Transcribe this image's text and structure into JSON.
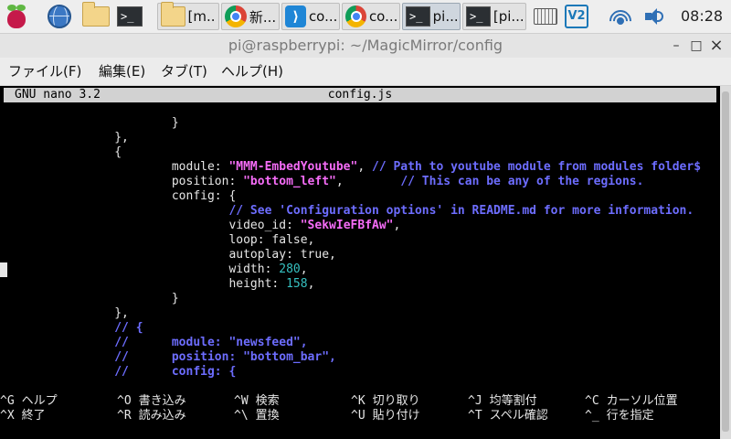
{
  "taskbar": {
    "items": [
      {
        "icon": "raspberry-pi-menu-icon"
      },
      {
        "icon": "web-browser-icon"
      },
      {
        "icon": "file-manager-icon"
      },
      {
        "icon": "terminal-icon",
        "label": ">_"
      },
      {
        "icon": "folder-icon",
        "label": "[m..."
      },
      {
        "icon": "chromium-icon",
        "label": "新..."
      },
      {
        "icon": "vscode-icon",
        "label": "co..."
      },
      {
        "icon": "chromium-icon",
        "label": "co..."
      },
      {
        "icon": "terminal-icon",
        "label": "pi..."
      },
      {
        "icon": "terminal-icon",
        "label": "[pi..."
      }
    ],
    "clock": "08:28"
  },
  "window": {
    "title": "pi@raspberrypi: ~/MagicMirror/config",
    "controls": {
      "minimize": "–",
      "maximize": "□",
      "close": "×"
    }
  },
  "menubar": [
    {
      "label": "ファイル(F)"
    },
    {
      "label": "編集(E)"
    },
    {
      "label": "タブ(T)"
    },
    {
      "label": "ヘルプ(H)"
    }
  ],
  "nano": {
    "version": "GNU nano 3.2",
    "filename": "config.js"
  },
  "code_lines": [
    [
      {
        "t": "                        }",
        "c": "kw"
      }
    ],
    [
      {
        "t": "                },",
        "c": "kw"
      }
    ],
    [
      {
        "t": "                {",
        "c": "kw"
      }
    ],
    [
      {
        "t": "                        module: ",
        "c": "kw"
      },
      {
        "t": "\"MMM-EmbedYoutube\"",
        "c": "str"
      },
      {
        "t": ", ",
        "c": "kw"
      },
      {
        "t": "// Path to youtube module from modules folder$",
        "c": "cm"
      }
    ],
    [
      {
        "t": "                        position: ",
        "c": "kw"
      },
      {
        "t": "\"bottom_left\"",
        "c": "str"
      },
      {
        "t": ",        ",
        "c": "kw"
      },
      {
        "t": "// This can be any of the regions.",
        "c": "cm"
      }
    ],
    [
      {
        "t": "                        config: {",
        "c": "kw"
      }
    ],
    [
      {
        "t": "                                ",
        "c": "kw"
      },
      {
        "t": "// See 'Configuration options' in README.md for more information.",
        "c": "cm"
      }
    ],
    [
      {
        "t": "                                video_id: ",
        "c": "kw"
      },
      {
        "t": "\"SekwIeFBfAw\"",
        "c": "str"
      },
      {
        "t": ",",
        "c": "kw"
      }
    ],
    [
      {
        "t": "                                loop: false,",
        "c": "kw"
      }
    ],
    [
      {
        "t": "                                autoplay: true,",
        "c": "kw"
      }
    ],
    [
      {
        "t": "                                width: ",
        "c": "kw"
      },
      {
        "t": "280",
        "c": "num"
      },
      {
        "t": ",",
        "c": "kw"
      }
    ],
    [
      {
        "t": "                                height: ",
        "c": "kw"
      },
      {
        "t": "158",
        "c": "num"
      },
      {
        "t": ",",
        "c": "kw"
      }
    ],
    [
      {
        "t": "                        }",
        "c": "kw"
      }
    ],
    [
      {
        "t": "                },",
        "c": "kw"
      }
    ],
    [
      {
        "t": "                // {",
        "c": "cm"
      }
    ],
    [
      {
        "t": "                //      module: \"newsfeed\",",
        "c": "cm"
      }
    ],
    [
      {
        "t": "                //      position: \"bottom_bar\",",
        "c": "cm"
      }
    ],
    [
      {
        "t": "                //      config: {",
        "c": "cm"
      }
    ]
  ],
  "shortcuts": [
    {
      "key": "^G",
      "label": "ヘルプ"
    },
    {
      "key": "^O",
      "label": "書き込み"
    },
    {
      "key": "^W",
      "label": "検索"
    },
    {
      "key": "^K",
      "label": "切り取り"
    },
    {
      "key": "^J",
      "label": "均等割付"
    },
    {
      "key": "^C",
      "label": "カーソル位置"
    },
    {
      "key": "^X",
      "label": "終了"
    },
    {
      "key": "^R",
      "label": "読み込み"
    },
    {
      "key": "^\\",
      "label": "置換"
    },
    {
      "key": "^U",
      "label": "貼り付け"
    },
    {
      "key": "^T",
      "label": "スペル確認"
    },
    {
      "key": "^_",
      "label": "行を指定"
    }
  ]
}
